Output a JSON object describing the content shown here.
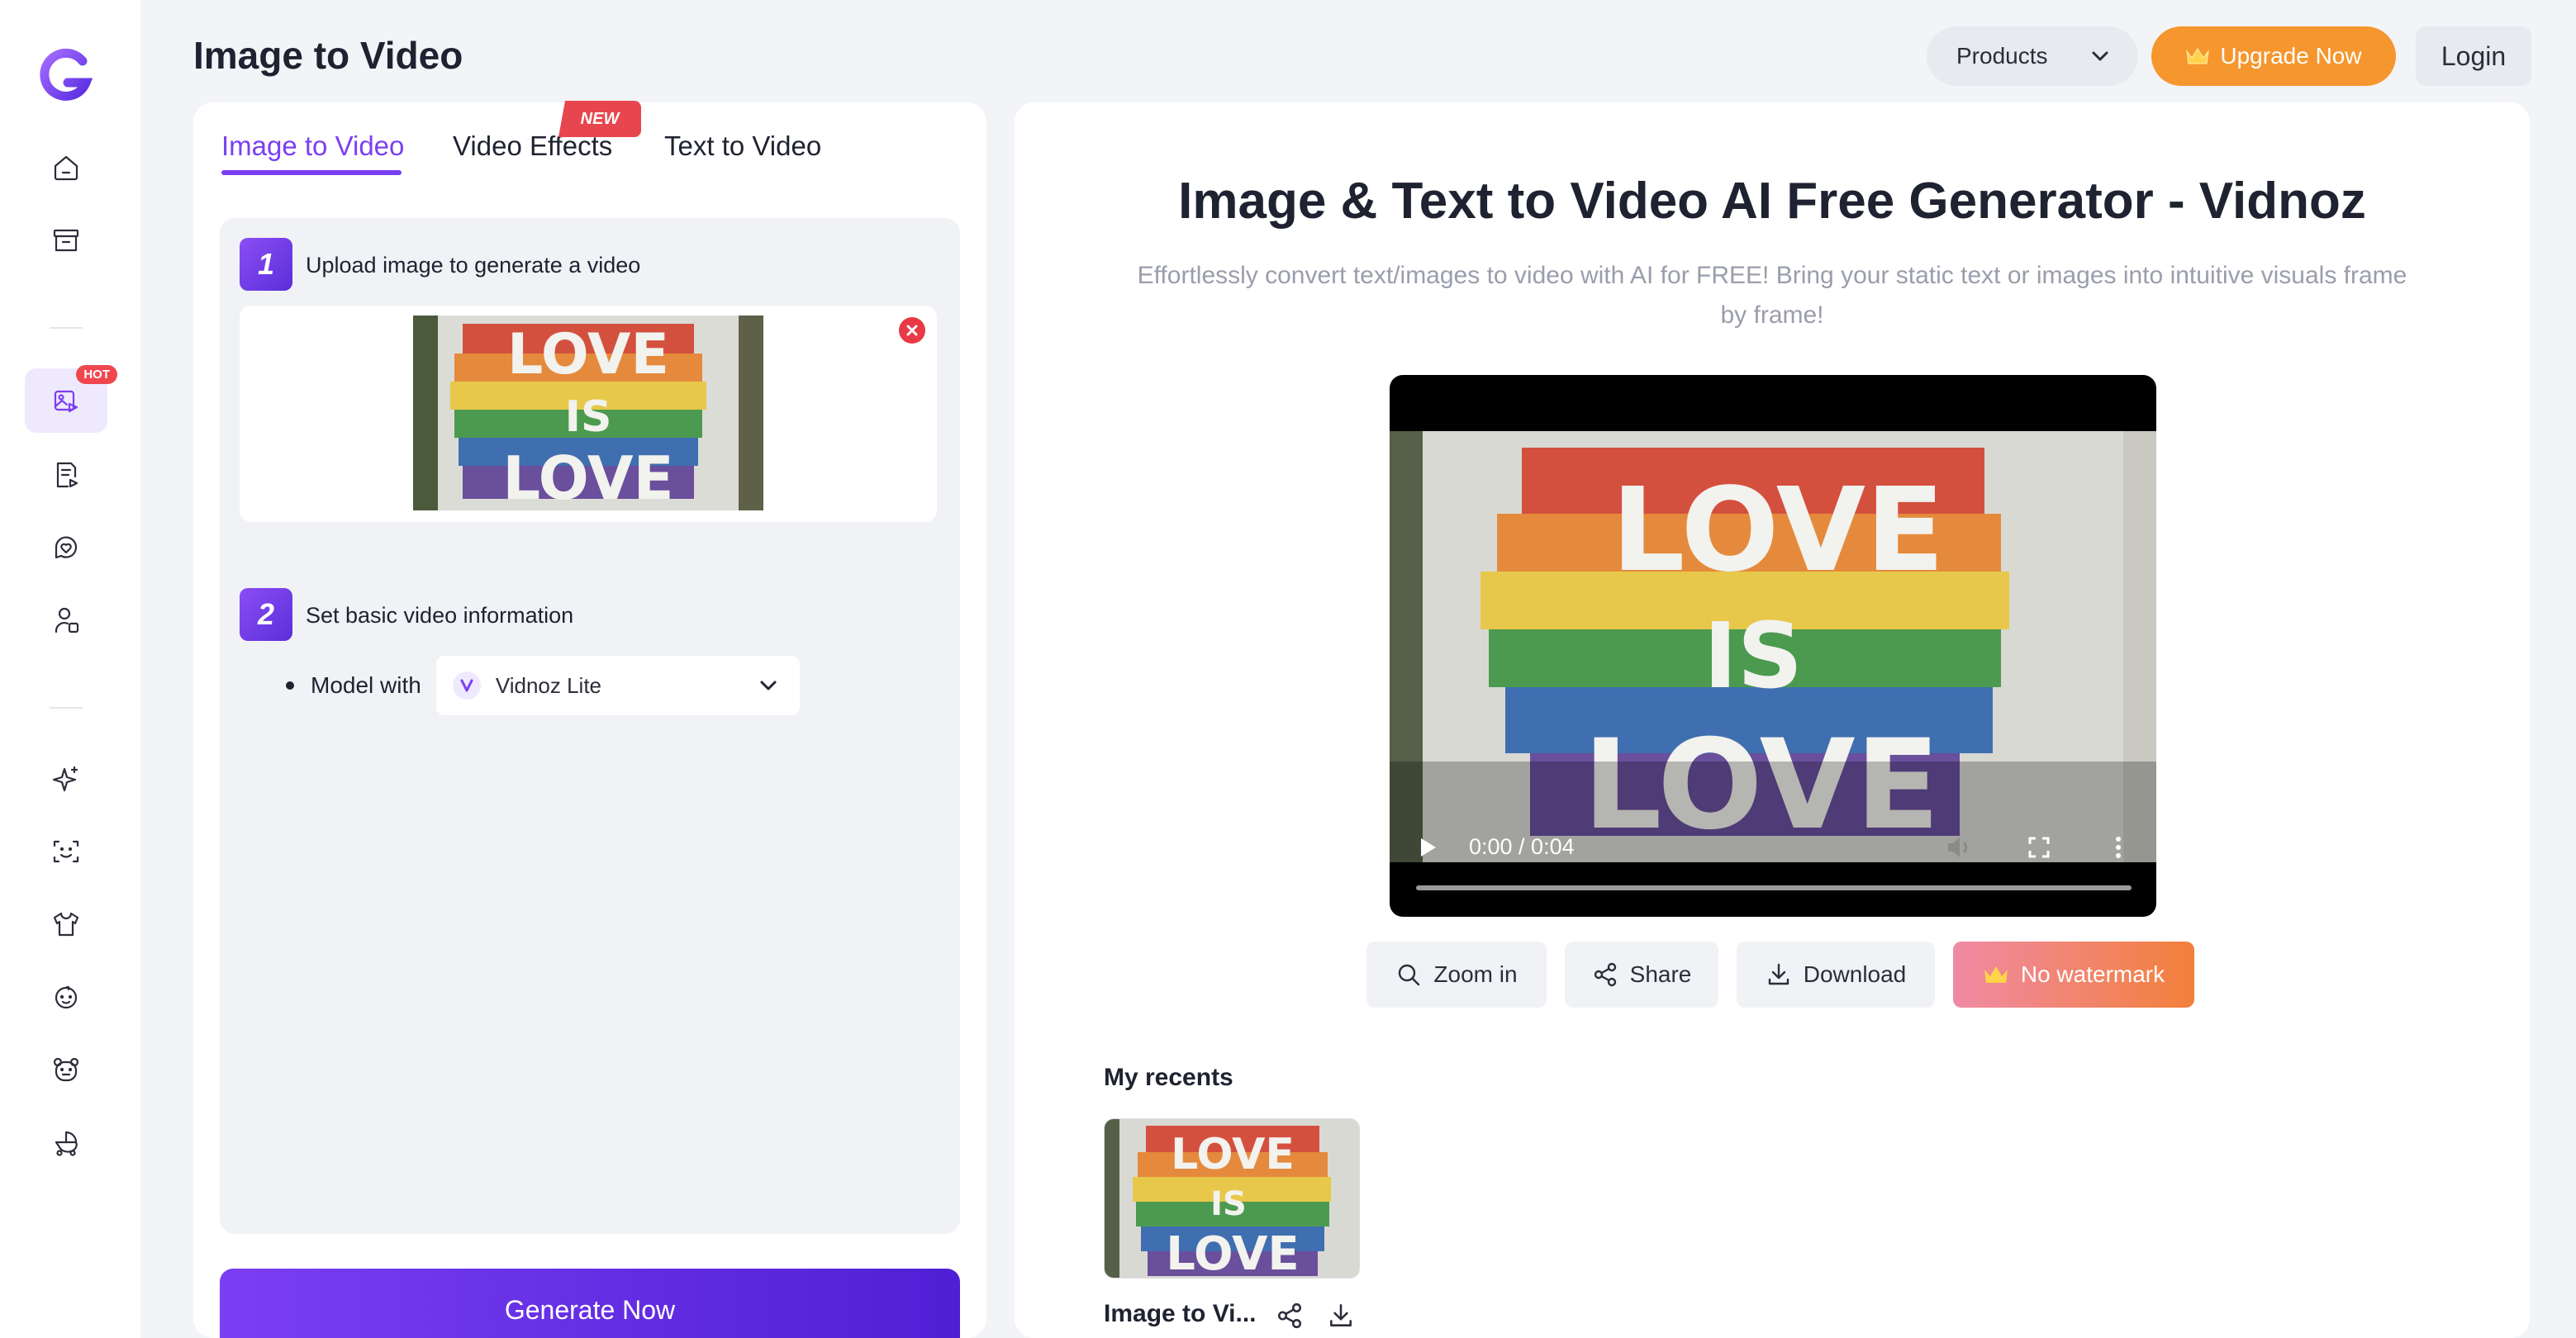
{
  "header": {
    "page_title": "Image to Video",
    "products_label": "Products",
    "upgrade_label": "Upgrade Now",
    "login_label": "Login"
  },
  "sidebar": {
    "hot_badge": "HOT",
    "items": [
      {
        "icon": "home-icon"
      },
      {
        "icon": "archive-icon"
      },
      {
        "icon": "image-to-video-icon",
        "active": true
      },
      {
        "icon": "document-video-icon"
      },
      {
        "icon": "heart-chat-icon"
      },
      {
        "icon": "avatar-icon"
      },
      {
        "icon": "sparkle-icon"
      },
      {
        "icon": "face-scan-icon"
      },
      {
        "icon": "shirt-icon"
      },
      {
        "icon": "baby-face-icon"
      },
      {
        "icon": "bear-face-icon"
      },
      {
        "icon": "stroller-icon"
      }
    ]
  },
  "tabs": [
    {
      "label": "Image to Video",
      "active": true
    },
    {
      "label": "Video Effects",
      "badge": "NEW"
    },
    {
      "label": "Text to Video"
    }
  ],
  "steps": {
    "step1": {
      "number": "1",
      "title": "Upload image to generate a video"
    },
    "step2": {
      "number": "2",
      "title": "Set basic video information"
    }
  },
  "model": {
    "label": "Model with",
    "value": "Vidnoz Lite"
  },
  "generate_label": "Generate Now",
  "main": {
    "heading": "Image & Text to Video AI Free Generator - Vidnoz",
    "subheading": "Effortlessly convert text/images to video with AI for FREE! Bring your static text or images into intuitive visuals frame by frame!"
  },
  "video": {
    "time": "0:00 / 0:04",
    "progress": 0
  },
  "actions": {
    "zoom_in": "Zoom in",
    "share": "Share",
    "download": "Download",
    "no_watermark": "No watermark"
  },
  "recents": {
    "title": "My recents",
    "items": [
      {
        "name": "Image to Vi..."
      }
    ]
  },
  "colors": {
    "accent": "#7b3ff2",
    "upgrade": "#f5962e",
    "hot": "#f0474f"
  }
}
